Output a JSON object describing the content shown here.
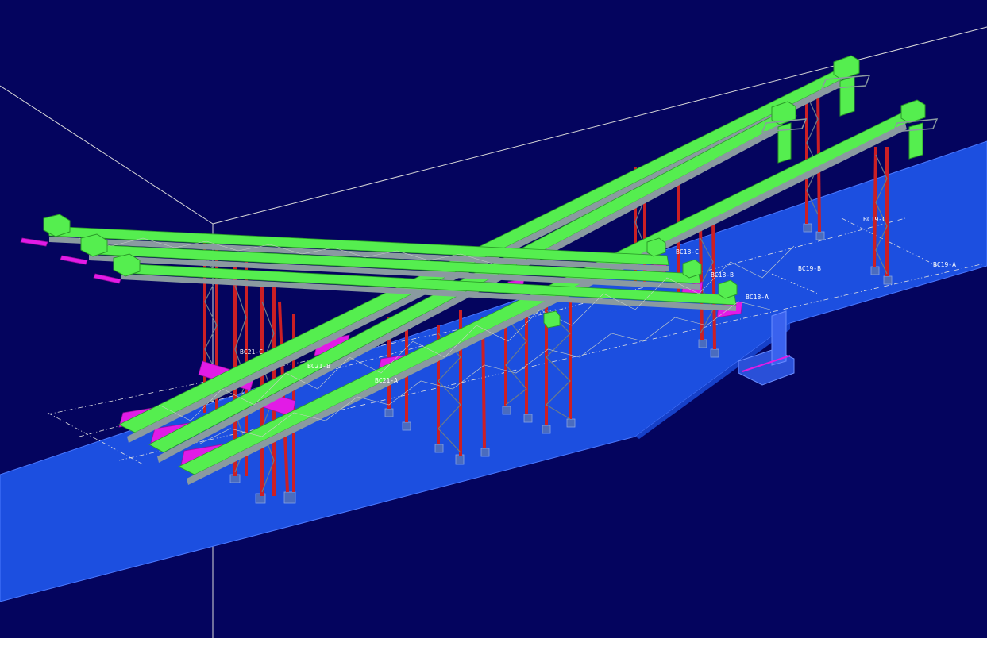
{
  "scene": {
    "background_color": "#04045e",
    "ground_color": "#1c4fe0",
    "ground_edge_color": "#4a78ff",
    "truss_color": "#55ee4f",
    "column_color": "#cc1f24",
    "lacing_color": "#9aa0a0",
    "chute_color": "#e21be6",
    "footing_color": "#4a6cbf",
    "label_color": "#ffffff",
    "grid_line_color": "#d8d8d8"
  },
  "conveyors": {
    "bc19a": {
      "label": "BC19-A"
    },
    "bc19b": {
      "label": "BC19-B"
    },
    "bc19c": {
      "label": "BC19-C"
    },
    "bc18a": {
      "label": "BC18-A"
    },
    "bc18b": {
      "label": "BC18-B"
    },
    "bc18c": {
      "label": "BC18-C"
    },
    "bc21a": {
      "label": "BC21-A"
    },
    "bc21b": {
      "label": "BC21-B"
    },
    "bc21c": {
      "label": "BC21-C"
    }
  }
}
